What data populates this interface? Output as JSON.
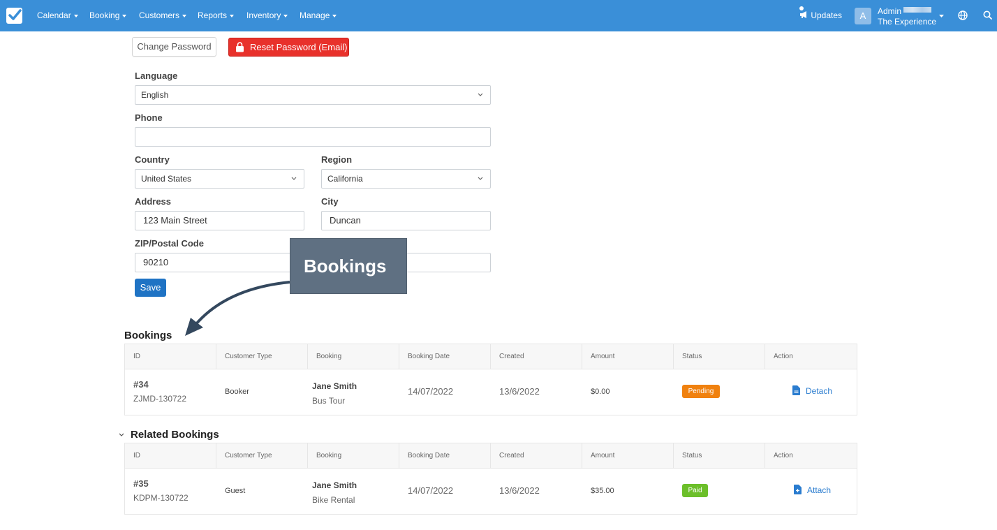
{
  "nav": {
    "items": [
      {
        "label": "Calendar"
      },
      {
        "label": "Booking"
      },
      {
        "label": "Customers"
      },
      {
        "label": "Reports"
      },
      {
        "label": "Inventory"
      },
      {
        "label": "Manage"
      }
    ],
    "updates_label": "Updates",
    "avatar_initial": "A",
    "admin_name": "Admin",
    "admin_org": "The Experience"
  },
  "actions": {
    "change_password_label": "Change Password",
    "reset_password_label": "Reset Password (Email)"
  },
  "form": {
    "language": {
      "label": "Language",
      "value": "English"
    },
    "phone": {
      "label": "Phone",
      "value": ""
    },
    "country": {
      "label": "Country",
      "value": "United States"
    },
    "region": {
      "label": "Region",
      "value": "California"
    },
    "address": {
      "label": "Address",
      "value": "123 Main Street"
    },
    "city": {
      "label": "City",
      "value": "Duncan"
    },
    "zip": {
      "label": "ZIP/Postal Code",
      "value": "90210"
    },
    "save_label": "Save"
  },
  "callout": {
    "text": "Bookings"
  },
  "bookings": {
    "title": "Bookings",
    "columns": [
      "ID",
      "Customer Type",
      "Booking",
      "Booking Date",
      "Created",
      "Amount",
      "Status",
      "Action"
    ],
    "rows": [
      {
        "id": "#34",
        "code": "ZJMD-130722",
        "customer_type": "Booker",
        "name": "Jane Smith",
        "product": "Bus Tour",
        "booking_date": "14/07/2022",
        "created": "13/6/2022",
        "amount": "$0.00",
        "status": "Pending",
        "action": "Detach"
      }
    ]
  },
  "related": {
    "title": "Related Bookings",
    "columns": [
      "ID",
      "Customer Type",
      "Booking",
      "Booking Date",
      "Created",
      "Amount",
      "Status",
      "Action"
    ],
    "rows": [
      {
        "id": "#35",
        "code": "KDPM-130722",
        "customer_type": "Guest",
        "name": "Jane Smith",
        "product": "Bike Rental",
        "booking_date": "14/07/2022",
        "created": "13/6/2022",
        "amount": "$35.00",
        "status": "Paid",
        "action": "Attach"
      }
    ]
  },
  "colors": {
    "nav_bg": "#3a8fd8",
    "reset_red": "#e8312b",
    "save_blue": "#1f73c4",
    "pending": "#f0810f",
    "paid": "#6cbf2a",
    "link": "#2a7ccf",
    "callout_bg": "#5f7082"
  }
}
